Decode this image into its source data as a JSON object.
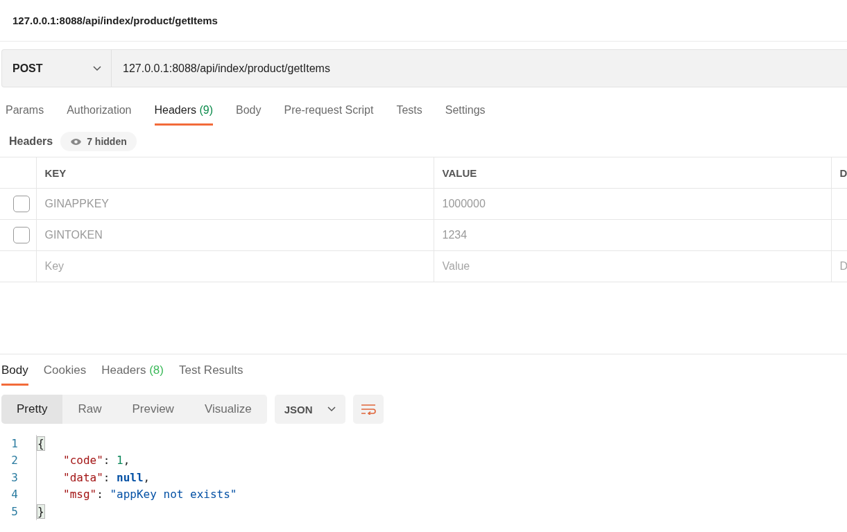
{
  "request_title": "127.0.0.1:8088/api/index/product/getItems",
  "request_bar": {
    "method": "POST",
    "url": "127.0.0.1:8088/api/index/product/getItems"
  },
  "request_tabs": [
    {
      "label": "Params",
      "selected": false
    },
    {
      "label": "Authorization",
      "selected": false
    },
    {
      "label": "Headers",
      "count": "(9)",
      "selected": true
    },
    {
      "label": "Body",
      "selected": false
    },
    {
      "label": "Pre-request Script",
      "selected": false
    },
    {
      "label": "Tests",
      "selected": false
    },
    {
      "label": "Settings",
      "selected": false
    }
  ],
  "headers_section": {
    "title": "Headers",
    "hidden_badge": "7 hidden"
  },
  "headers_table": {
    "columns": [
      "KEY",
      "VALUE",
      "D"
    ],
    "rows": [
      {
        "checked": false,
        "key": "GINAPPKEY",
        "value": "1000000"
      },
      {
        "checked": false,
        "key": "GINTOKEN",
        "value": "1234"
      }
    ],
    "new_row": {
      "key_placeholder": "Key",
      "value_placeholder": "Value",
      "column_3_placeholder": "D"
    }
  },
  "response_tabs": [
    {
      "label": "Body",
      "selected": true
    },
    {
      "label": "Cookies",
      "selected": false
    },
    {
      "label": "Headers",
      "count": "(8)",
      "selected": false
    },
    {
      "label": "Test Results",
      "selected": false
    }
  ],
  "view_modes": [
    {
      "label": "Pretty",
      "selected": true
    },
    {
      "label": "Raw",
      "selected": false
    },
    {
      "label": "Preview",
      "selected": false
    },
    {
      "label": "Visualize",
      "selected": false
    }
  ],
  "format_dropdown": "JSON",
  "code_lines": [
    {
      "number": "1",
      "indented": false,
      "tokens": [
        {
          "kind": "brace",
          "text": "{"
        }
      ]
    },
    {
      "number": "2",
      "indented": true,
      "tokens": [
        {
          "kind": "key",
          "text": "\"code\""
        },
        {
          "kind": "punct",
          "text": ": "
        },
        {
          "kind": "number",
          "text": "1"
        },
        {
          "kind": "punct",
          "text": ","
        }
      ]
    },
    {
      "number": "3",
      "indented": true,
      "tokens": [
        {
          "kind": "key",
          "text": "\"data\""
        },
        {
          "kind": "punct",
          "text": ": "
        },
        {
          "kind": "keyword",
          "text": "null"
        },
        {
          "kind": "punct",
          "text": ","
        }
      ]
    },
    {
      "number": "4",
      "indented": true,
      "tokens": [
        {
          "kind": "key",
          "text": "\"msg\""
        },
        {
          "kind": "punct",
          "text": ": "
        },
        {
          "kind": "string",
          "text": "\"appKey not exists\""
        }
      ]
    },
    {
      "number": "5",
      "indented": false,
      "tokens": [
        {
          "kind": "brace",
          "text": "}"
        }
      ]
    }
  ]
}
